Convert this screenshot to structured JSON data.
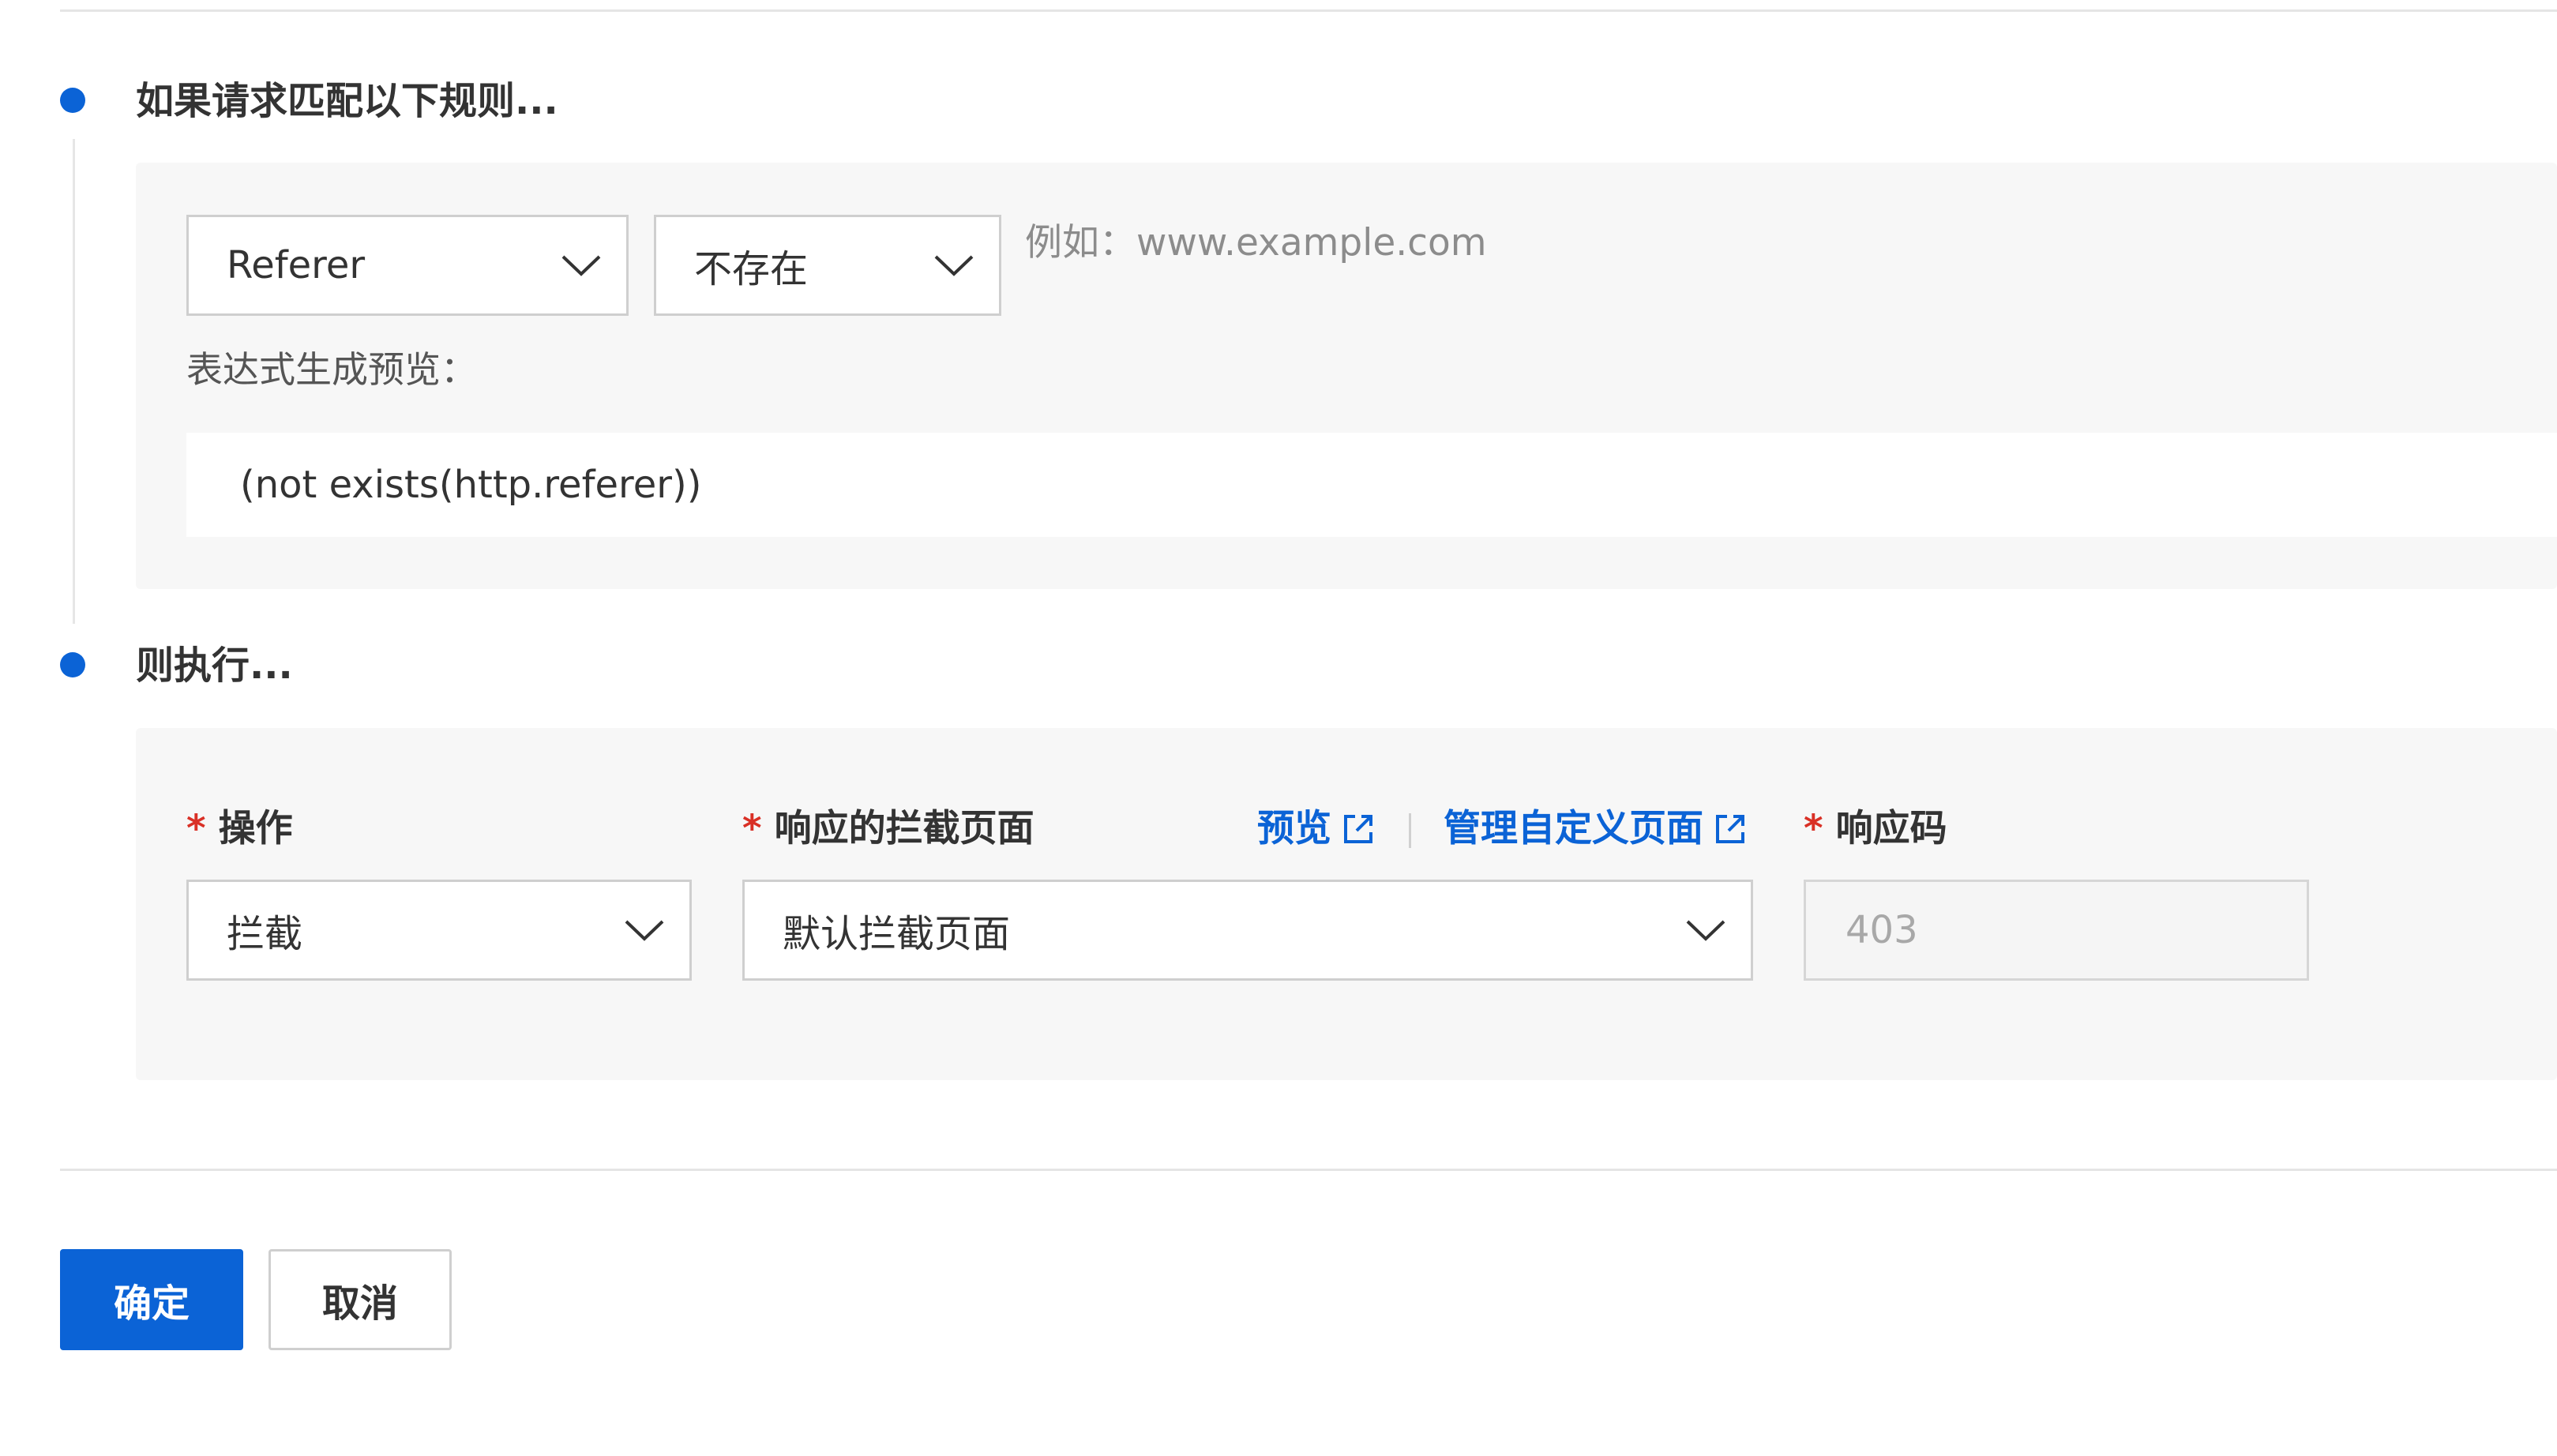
{
  "condition_section": {
    "title": "如果请求匹配以下规则...",
    "field_select": {
      "value": "Referer"
    },
    "operator_select": {
      "value": "不存在"
    },
    "value_hint": "例如：www.example.com",
    "expression_preview_label": "表达式生成预览：",
    "expression_preview_value": "(not exists(http.referer))"
  },
  "action_section": {
    "title": "则执行...",
    "required_mark": "*",
    "operation": {
      "label": "操作",
      "value": "拦截"
    },
    "block_page": {
      "label": "响应的拦截页面",
      "preview_link": "预览",
      "manage_link": "管理自定义页面",
      "value": "默认拦截页面"
    },
    "response_code": {
      "label": "响应码",
      "value": "403"
    }
  },
  "footer": {
    "confirm_label": "确定",
    "cancel_label": "取消"
  },
  "colors": {
    "accent": "#0b63d6",
    "required": "#d93026",
    "panel_bg": "#f7f7f7"
  },
  "icons": {
    "select_arrow": "chevron-down-icon",
    "external_link": "external-link-icon",
    "step_marker": "timeline-dot-icon"
  }
}
